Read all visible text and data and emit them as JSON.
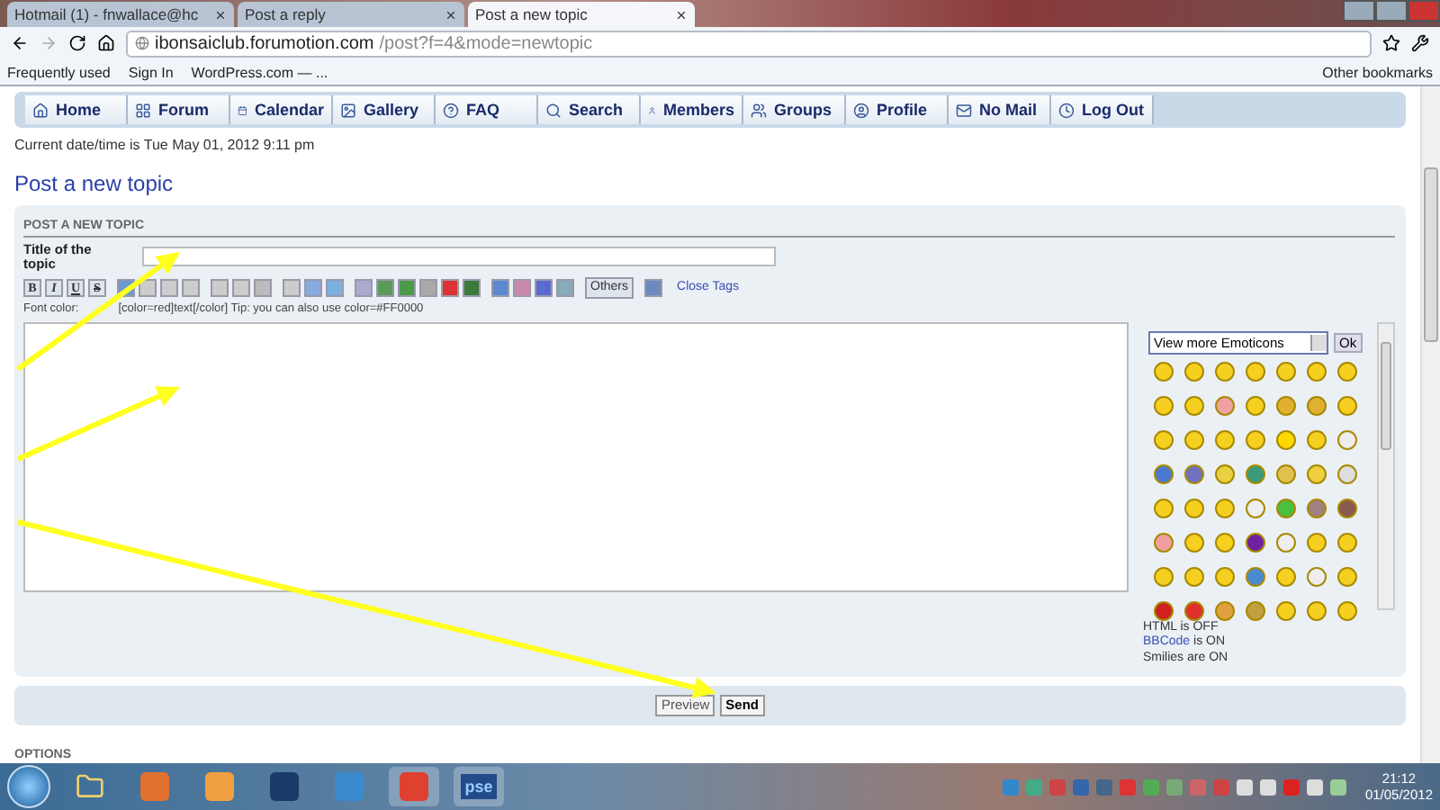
{
  "browser": {
    "tabs": [
      {
        "label": "Hotmail (1) - fnwallace@hc",
        "selected": false
      },
      {
        "label": "Post a reply",
        "selected": false
      },
      {
        "label": "Post a new topic",
        "selected": true
      }
    ],
    "address": {
      "domain": "ibonsaiclub.forumotion.com",
      "path": "/post?f=4&mode=newtopic"
    },
    "bookmarks": [
      "Frequently used",
      "Sign In",
      "WordPress.com — ..."
    ],
    "other_bookmarks": "Other bookmarks"
  },
  "nav": [
    "Home",
    "Forum",
    "Calendar",
    "Gallery",
    "FAQ",
    "Search",
    "Members",
    "Groups",
    "Profile",
    "No Mail",
    "Log Out"
  ],
  "datetime": "Current date/time is Tue May 01, 2012 9:11 pm",
  "page_title": "Post a new topic",
  "form": {
    "section": "POST A NEW TOPIC",
    "title_label": "Title of the topic",
    "format_buttons": [
      "B",
      "I",
      "U",
      "S"
    ],
    "others": "Others",
    "close_tags": "Close Tags",
    "tip_label": "Font color:",
    "tip": "[color=red]text[/color] Tip: you can also use color=#FF0000",
    "emoticons_select": "View more Emoticons",
    "ok": "Ok",
    "status": [
      {
        "text": "HTML is OFF"
      },
      {
        "link": "BBCode",
        "text": " is ON"
      },
      {
        "text": "Smilies are ON"
      }
    ]
  },
  "buttons": [
    "Preview",
    "Send"
  ],
  "options": "OPTIONS",
  "taskbar": {
    "app_label": "pse",
    "time": "21:12",
    "date": "01/05/2012"
  }
}
